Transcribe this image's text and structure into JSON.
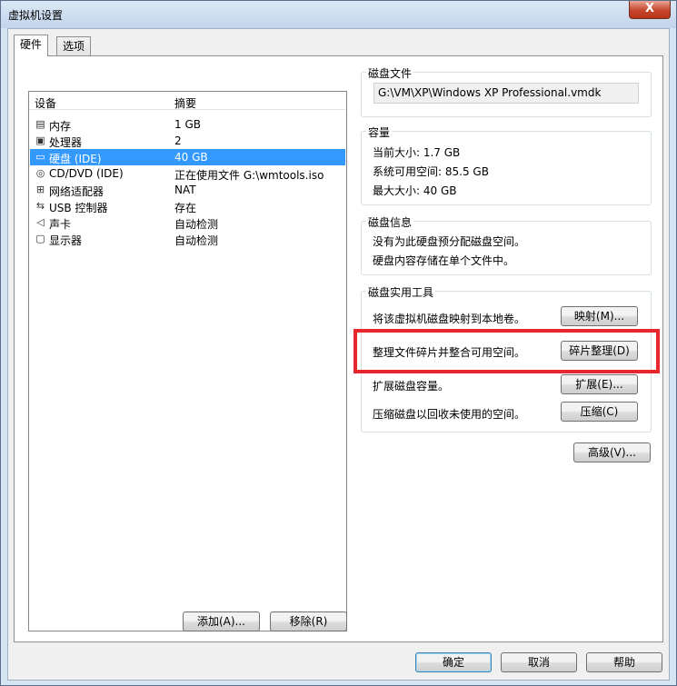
{
  "window": {
    "title": "虚拟机设置",
    "close_label": "X"
  },
  "tabs": [
    {
      "label": "硬件"
    },
    {
      "label": "选项"
    }
  ],
  "device_list": {
    "headers": {
      "device": "设备",
      "summary": "摘要"
    },
    "rows": [
      {
        "icon": "memory-icon",
        "name": "内存",
        "summary": "1 GB"
      },
      {
        "icon": "processor-icon",
        "name": "处理器",
        "summary": "2"
      },
      {
        "icon": "hard-disk-icon",
        "name": "硬盘 (IDE)",
        "summary": "40 GB",
        "selected": true
      },
      {
        "icon": "cd-dvd-icon",
        "name": "CD/DVD (IDE)",
        "summary": "正在使用文件 G:\\wmtools.iso"
      },
      {
        "icon": "network-icon",
        "name": "网络适配器",
        "summary": "NAT"
      },
      {
        "icon": "usb-icon",
        "name": "USB 控制器",
        "summary": "存在"
      },
      {
        "icon": "sound-icon",
        "name": "声卡",
        "summary": "自动检测"
      },
      {
        "icon": "display-icon",
        "name": "显示器",
        "summary": "自动检测"
      }
    ]
  },
  "list_buttons": {
    "add": "添加(A)...",
    "remove": "移除(R)"
  },
  "disk_file": {
    "title": "磁盘文件",
    "path": "G:\\VM\\XP\\Windows XP Professional.vmdk"
  },
  "capacity": {
    "title": "容量",
    "current_size": "当前大小: 1.7 GB",
    "free_space": "系统可用空间: 85.5 GB",
    "max_size": "最大大小: 40 GB"
  },
  "disk_info": {
    "title": "磁盘信息",
    "line1": "没有为此硬盘预分配磁盘空间。",
    "line2": "硬盘内容存储在单个文件中。"
  },
  "disk_utilities": {
    "title": "磁盘实用工具",
    "map_text": "将该虚拟机磁盘映射到本地卷。",
    "map_button": "映射(M)...",
    "defrag_text": "整理文件碎片并整合可用空间。",
    "defrag_button": "碎片整理(D)",
    "expand_text": "扩展磁盘容量。",
    "expand_button": "扩展(E)...",
    "compact_text": "压缩磁盘以回收未使用的空间。",
    "compact_button": "压缩(C)"
  },
  "advanced_button": "高级(V)...",
  "dialog_buttons": {
    "ok": "确定",
    "cancel": "取消",
    "help": "帮助"
  },
  "colors": {
    "selection": "#3399ff",
    "highlight": "#e8262d"
  }
}
